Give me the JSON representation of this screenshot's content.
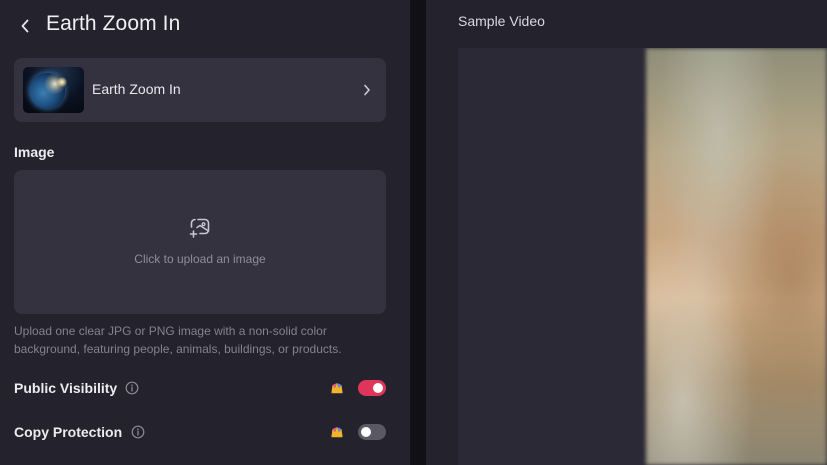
{
  "header": {
    "title": "Earth Zoom In"
  },
  "template_card": {
    "name": "Earth Zoom In"
  },
  "image_section": {
    "label": "Image",
    "upload_text": "Click to upload an image",
    "hint": "Upload one clear JPG or PNG image with a non-solid color background, featuring people, animals, buildings, or products."
  },
  "settings": {
    "public_visibility": {
      "label": "Public Visibility",
      "enabled": true
    },
    "copy_protection": {
      "label": "Copy Protection",
      "enabled": false
    }
  },
  "preview": {
    "title": "Sample Video"
  },
  "colors": {
    "panel_bg": "#24222d",
    "card_bg": "#35323f",
    "toggle_on": "#e0355a",
    "toggle_off": "#5b5866"
  },
  "icons": [
    "chevron-left-icon",
    "chevron-right-icon",
    "image-upload-icon",
    "info-icon",
    "crown-icon"
  ]
}
